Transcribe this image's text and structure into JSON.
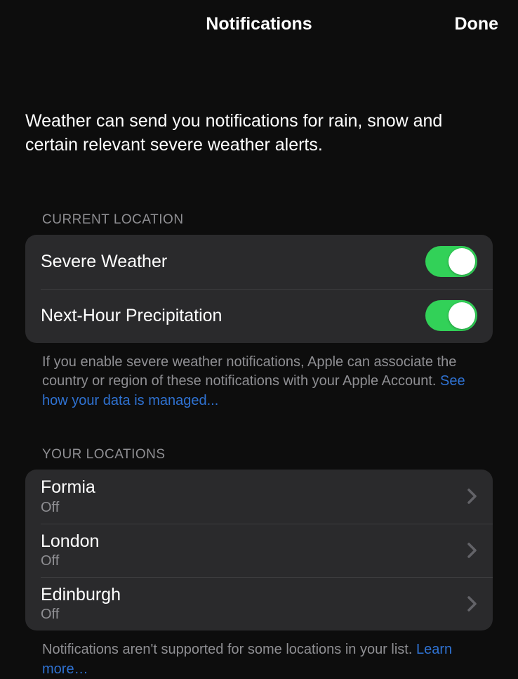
{
  "nav": {
    "title": "Notifications",
    "done": "Done"
  },
  "description": "Weather can send you notifications for rain, snow and certain relevant severe weather alerts.",
  "current_location": {
    "header": "CURRENT LOCATION",
    "rows": [
      {
        "label": "Severe Weather",
        "on": true
      },
      {
        "label": "Next-Hour Precipitation",
        "on": true
      }
    ],
    "footer_text": "If you enable severe weather notifications, Apple can associate the country or region of these notifications with your Apple Account. ",
    "footer_link": "See how your data is managed..."
  },
  "your_locations": {
    "header": "YOUR LOCATIONS",
    "rows": [
      {
        "name": "Formia",
        "status": "Off"
      },
      {
        "name": "London",
        "status": "Off"
      },
      {
        "name": "Edinburgh",
        "status": "Off"
      }
    ],
    "footer_text": "Notifications aren't supported for some locations in your list. ",
    "footer_link": "Learn more…"
  }
}
